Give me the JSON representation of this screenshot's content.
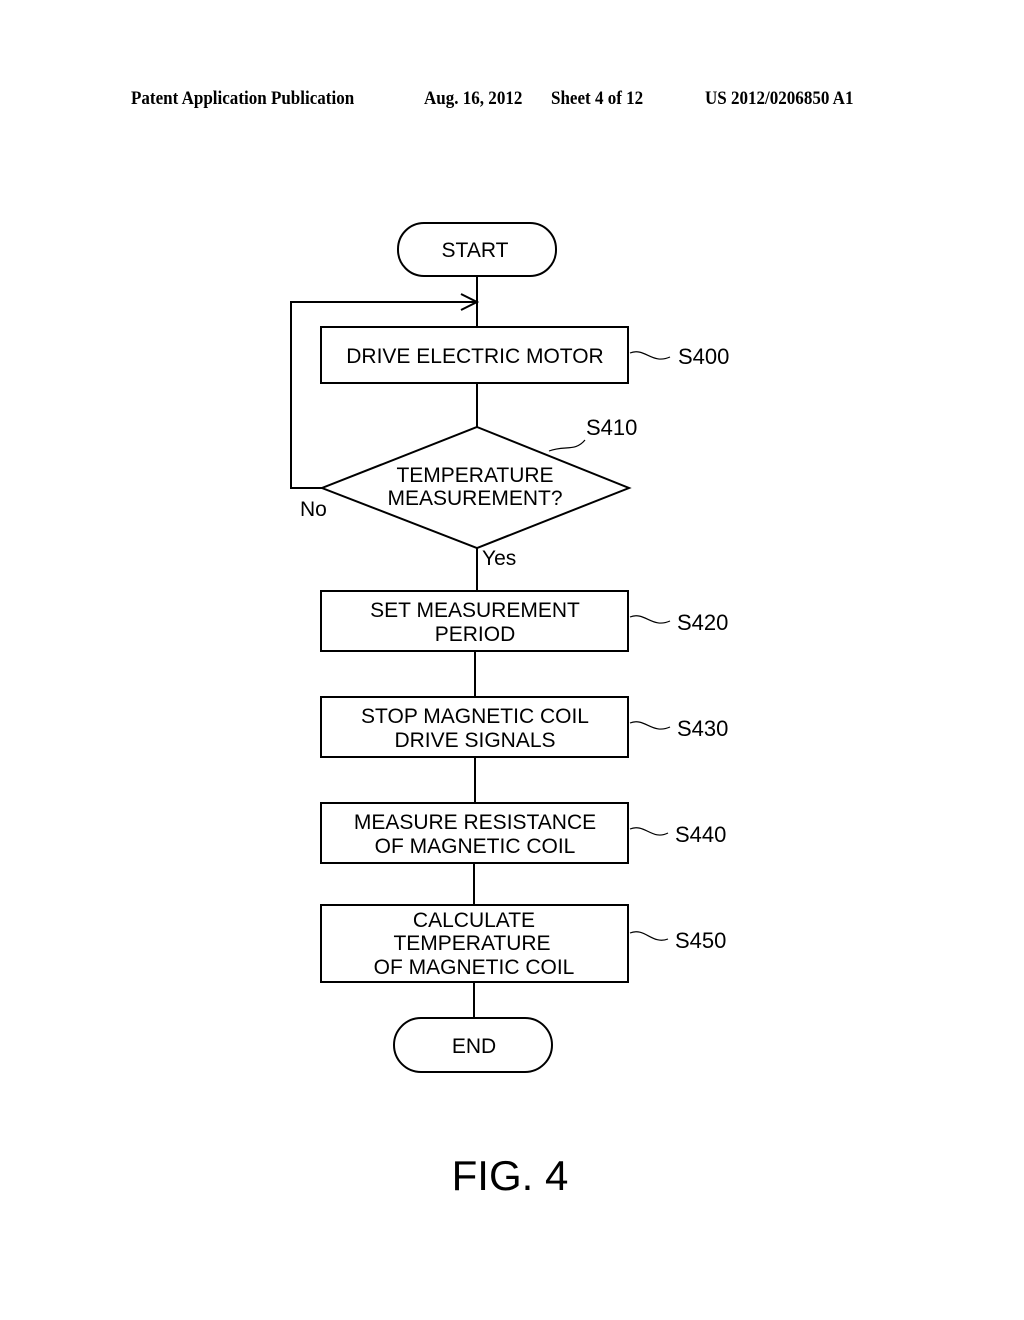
{
  "header": {
    "publication": "Patent Application Publication",
    "date": "Aug. 16, 2012",
    "sheet": "Sheet 4 of 12",
    "number": "US 2012/0206850 A1"
  },
  "flowchart": {
    "start": "START",
    "end": "END",
    "steps": [
      {
        "id": "S400",
        "lines": [
          "DRIVE ELECTRIC MOTOR"
        ]
      },
      {
        "id": "S410",
        "lines": [
          "TEMPERATURE",
          "MEASUREMENT?"
        ],
        "type": "decision",
        "no_label": "No",
        "yes_label": "Yes"
      },
      {
        "id": "S420",
        "lines": [
          "SET MEASUREMENT",
          "PERIOD"
        ]
      },
      {
        "id": "S430",
        "lines": [
          "STOP MAGNETIC COIL",
          "DRIVE SIGNALS"
        ]
      },
      {
        "id": "S440",
        "lines": [
          "MEASURE RESISTANCE",
          "OF MAGNETIC COIL"
        ]
      },
      {
        "id": "S450",
        "lines": [
          "CALCULATE",
          "TEMPERATURE",
          "OF MAGNETIC COIL"
        ]
      }
    ]
  },
  "figure_label": "FIG. 4"
}
